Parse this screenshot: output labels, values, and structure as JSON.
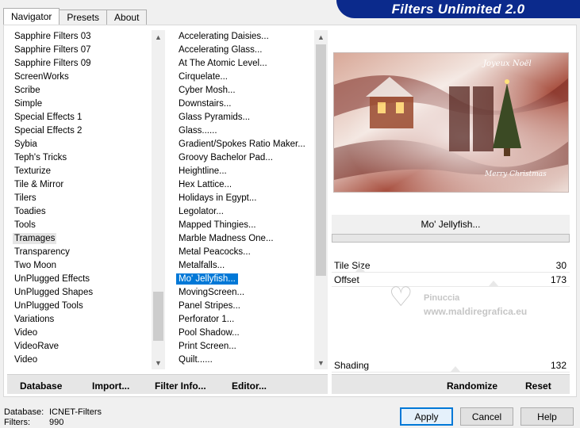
{
  "tabs": [
    "Navigator",
    "Presets",
    "About"
  ],
  "brand": "Filters Unlimited 2.0",
  "categories": [
    "Sapphire Filters 03",
    "Sapphire Filters 07",
    "Sapphire Filters 09",
    "ScreenWorks",
    "Scribe",
    "Simple",
    "Special Effects 1",
    "Special Effects 2",
    "Sybia",
    "Teph's Tricks",
    "Texturize",
    "Tile & Mirror",
    "Tilers",
    "Toadies",
    "Tools",
    "Tramages",
    "Transparency",
    "Two Moon",
    "UnPlugged Effects",
    "UnPlugged Shapes",
    "UnPlugged Tools",
    "Variations",
    "Video",
    "VideoRave",
    "Video"
  ],
  "categories_selected": "Tramages",
  "filters": [
    "Accelerating Daisies...",
    "Accelerating Glass...",
    "At The Atomic Level...",
    "Cirquelate...",
    "Cyber Mosh...",
    "Downstairs...",
    "Glass Pyramids...",
    "Glass......",
    "Gradient/Spokes Ratio Maker...",
    "Groovy Bachelor Pad...",
    "Heightline...",
    "Hex Lattice...",
    "Holidays in Egypt...",
    "Legolator...",
    "Mapped Thingies...",
    "Marble Madness One...",
    "Metal Peacocks...",
    "Metalfalls...",
    "Mo' Jellyfish...",
    "MovingScreen...",
    "Panel Stripes...",
    "Perforator 1...",
    "Pool Shadow...",
    "Print Screen...",
    "Quilt......"
  ],
  "filters_selected": "Mo' Jellyfish...",
  "bottom_buttons": {
    "database": "Database",
    "import": "Import...",
    "filter_info": "Filter Info...",
    "editor": "Editor...",
    "randomize": "Randomize",
    "reset": "Reset"
  },
  "current_filter": "Mo' Jellyfish...",
  "params": [
    {
      "label": "Tile Size",
      "value": "30",
      "level": 0.118
    },
    {
      "label": "Offset",
      "value": "173",
      "level": 0.678
    }
  ],
  "shading": {
    "label": "Shading",
    "value": "132",
    "level": 0.518
  },
  "preview": {
    "text_top": "Joyeux Noël",
    "text_bottom": "Merry Christmas",
    "watermark_name": "Pinuccia",
    "watermark_url": "www.maldiregrafica.eu"
  },
  "status": {
    "database_label": "Database:",
    "database_value": "ICNET-Filters",
    "filters_label": "Filters:",
    "filters_value": "990"
  },
  "dialog_buttons": {
    "apply": "Apply",
    "cancel": "Cancel",
    "help": "Help"
  },
  "colors": {
    "accent": "#0078d7",
    "brand_bg": "#0b2a8c"
  }
}
